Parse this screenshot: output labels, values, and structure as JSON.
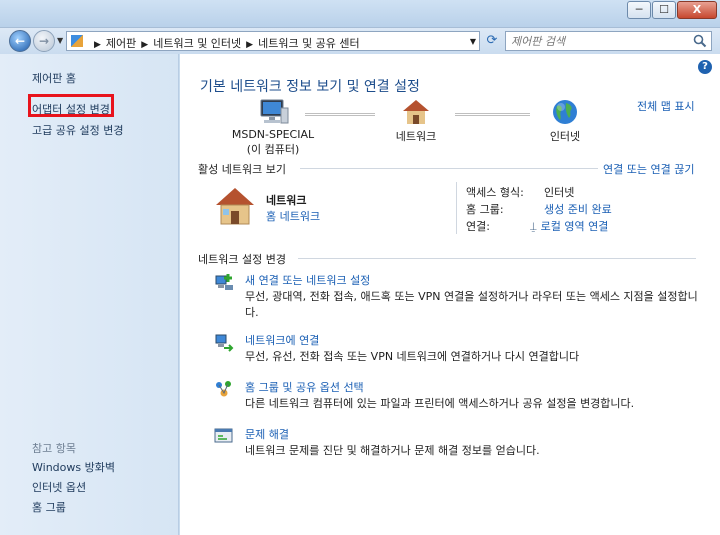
{
  "window": {
    "buttons": {
      "minimize": "─",
      "maximize": "☐",
      "close": "X"
    }
  },
  "nav": {
    "back": "←",
    "forward": "→",
    "breadcrumbs": [
      "제어판",
      "네트워크 및 인터넷",
      "네트워크 및 공유 센터"
    ],
    "search_placeholder": "제어판 검색"
  },
  "sidebar": {
    "home": "제어판 홈",
    "links": [
      "어댑터 설정 변경",
      "고급 공유 설정 변경"
    ],
    "see_also_title": "참고 항목",
    "see_also": [
      "Windows 방화벽",
      "인터넷 옵션",
      "홈 그룹"
    ]
  },
  "main": {
    "title": "기본 네트워크 정보 보기 및 연결 설정",
    "full_map": "전체 맵 표시",
    "map": {
      "computer_name": "MSDN-SPECIAL",
      "computer_sub": "(이 컴퓨터)",
      "network": "네트워크",
      "internet": "인터넷"
    },
    "active_section_title": "활성 네트워크 보기",
    "connect_or_disconnect": "연결 또는 연결 끊기",
    "active_network": {
      "name": "네트워크",
      "type": "홈 네트워크",
      "props": [
        {
          "label": "액세스 형식:",
          "value": "인터넷"
        },
        {
          "label": "홈 그룹:",
          "value": "생성 준비 완료"
        },
        {
          "label": "연결:",
          "value": "로컬 영역 연결"
        }
      ]
    },
    "settings_section_title": "네트워크 설정 변경",
    "tasks": [
      {
        "title": "새 연결 또는 네트워크 설정",
        "desc": "무선, 광대역, 전화 접속, 애드혹 또는 VPN 연결을 설정하거나 라우터 또는 액세스 지점을 설정합니다."
      },
      {
        "title": "네트워크에 연결",
        "desc": "무선, 유선, 전화 접속 또는 VPN 네트워크에 연결하거나 다시 연결합니다"
      },
      {
        "title": "홈 그룹 및 공유 옵션 선택",
        "desc": "다른 네트워크 컴퓨터에 있는 파일과 프린터에 액세스하거나 공유 설정을 변경합니다."
      },
      {
        "title": "문제 해결",
        "desc": "네트워크 문제를 진단 및 해결하거나 문제 해결 정보를 얻습니다."
      }
    ]
  },
  "colors": {
    "link": "#1a5fb4",
    "title": "#1e4e8c",
    "highlight_box": "#e8131c"
  }
}
